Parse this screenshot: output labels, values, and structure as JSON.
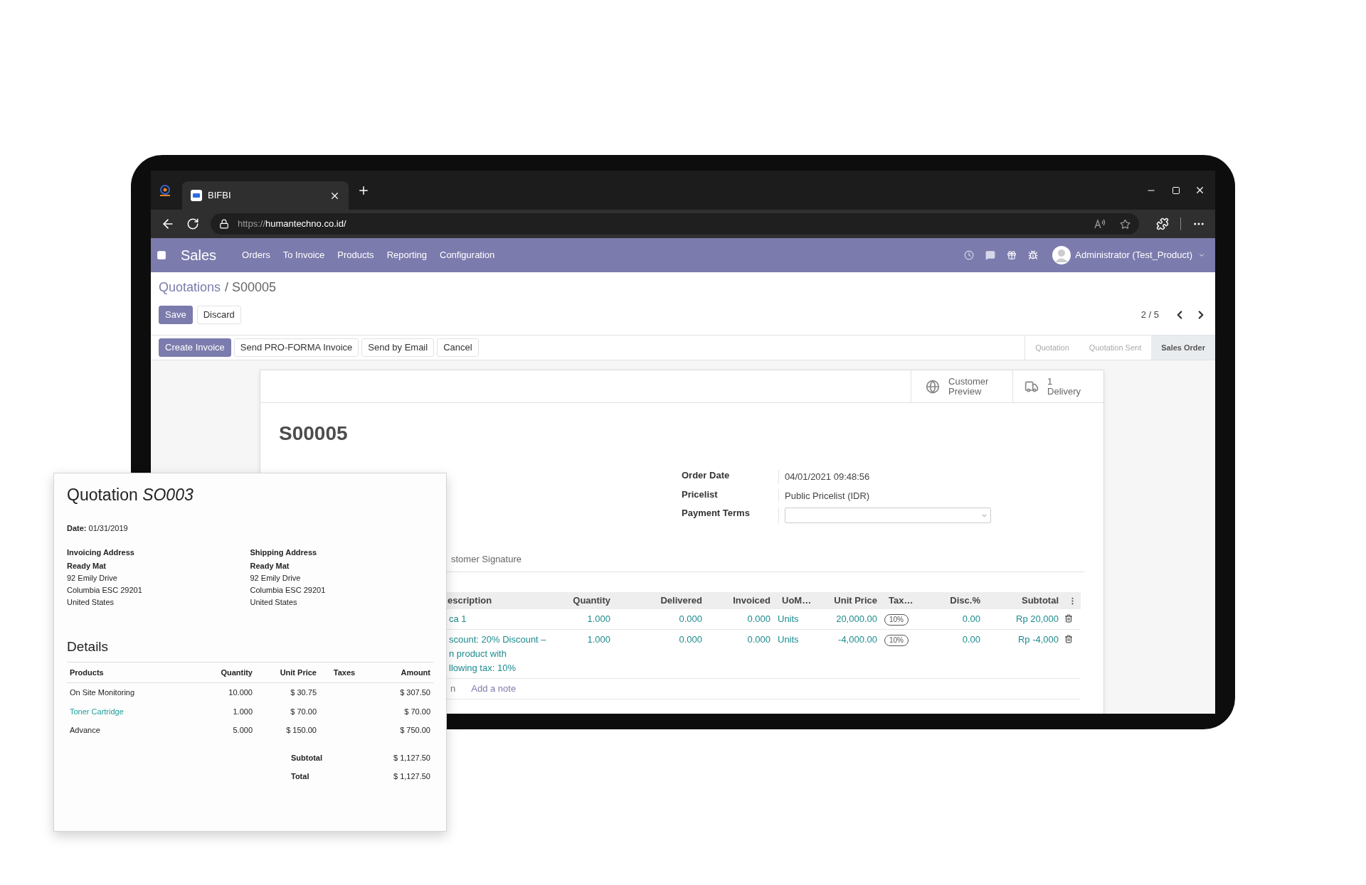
{
  "browser": {
    "tab_title": "BIFBI",
    "url": {
      "scheme": "https://",
      "host": "humantechno.co.id/"
    }
  },
  "navbar": {
    "app": "Sales",
    "menu": [
      "Orders",
      "To Invoice",
      "Products",
      "Reporting",
      "Configuration"
    ],
    "user": "Administrator (Test_Product)"
  },
  "breadcrumb": {
    "parent": "Quotations",
    "current": "/ S00005"
  },
  "form_buttons": [
    {
      "label": "Save",
      "primary": true
    },
    {
      "label": "Discard",
      "primary": false
    }
  ],
  "pager": "2 / 5",
  "actions": [
    {
      "label": "Create Invoice",
      "primary": true
    },
    {
      "label": "Send PRO-FORMA Invoice",
      "primary": false
    },
    {
      "label": "Send by Email",
      "primary": false
    },
    {
      "label": "Cancel",
      "primary": false
    }
  ],
  "stages": [
    {
      "label": "Quotation",
      "selected": false
    },
    {
      "label": "Quotation Sent",
      "selected": false
    },
    {
      "label": "Sales Order",
      "selected": true
    }
  ],
  "smart_buttons": [
    {
      "kind": "preview",
      "label": "Customer Preview"
    },
    {
      "kind": "delivery",
      "count": "1",
      "label": "Delivery"
    }
  ],
  "record": {
    "name": "S00005",
    "fields": [
      {
        "kind": "text",
        "label": "Order Date",
        "value": "04/01/2021 09:48:56"
      },
      {
        "kind": "text",
        "label": "Pricelist",
        "value": "Public Pricelist (IDR)"
      },
      {
        "kind": "select",
        "label": "Payment Terms"
      }
    ]
  },
  "notebook_tab": "stomer Signature",
  "order_lines": {
    "columns": [
      "escription",
      "Quantity",
      "Delivered",
      "Invoiced",
      "UoM…",
      "Unit Price",
      "Tax…",
      "Disc.%",
      "Subtotal"
    ],
    "rows": [
      {
        "description": [
          "ca 1"
        ],
        "quantity": "1.000",
        "delivered": "0.000",
        "invoiced": "0.000",
        "uom": "Units",
        "unit_price": "20,000.00",
        "tax": "10%",
        "discount": "0.00",
        "subtotal": "Rp 20,000"
      },
      {
        "description": [
          "scount: 20% Discount –",
          "n product with",
          "llowing tax: 10%"
        ],
        "quantity": "1.000",
        "delivered": "0.000",
        "invoiced": "0.000",
        "uom": "Units",
        "unit_price": "-4,000.00",
        "tax": "10%",
        "discount": "0.00",
        "subtotal": "Rp -4,000"
      }
    ],
    "footer": {
      "column_1": "n",
      "add_note": "Add a note"
    }
  },
  "quotation_document": {
    "title": "Quotation *SO003*",
    "date": "**Date:** 01/31/2019",
    "addresses": [
      {
        "heading": "Invoicing Address",
        "name": "Ready Mat",
        "lines": [
          "92 Emily Drive",
          "Columbia ESC 29201",
          "United States"
        ]
      },
      {
        "heading": "Shipping Address",
        "name": "Ready Mat",
        "lines": [
          "92 Emily Drive",
          "Columbia ESC 29201",
          "United States"
        ]
      }
    ],
    "details_heading": "Details",
    "columns": [
      "Products",
      "Quantity",
      "Unit Price",
      "Taxes",
      "Amount"
    ],
    "rows": [
      {
        "product": "On Site Monitoring",
        "link": false,
        "quantity": "10.000",
        "unit_price": "$ 30.75",
        "amount": "$ 307.50"
      },
      {
        "product": "Toner Cartridge",
        "link": true,
        "quantity": "1.000",
        "unit_price": "$ 70.00",
        "amount": "$ 70.00"
      },
      {
        "product": "Advance",
        "link": false,
        "quantity": "5.000",
        "unit_price": "$ 150.00",
        "amount": "$ 750.00"
      }
    ],
    "totals": [
      {
        "label": "Subtotal",
        "value": "$ 1,127.50"
      },
      {
        "label": "Total",
        "value": "$ 1,127.50"
      }
    ]
  }
}
